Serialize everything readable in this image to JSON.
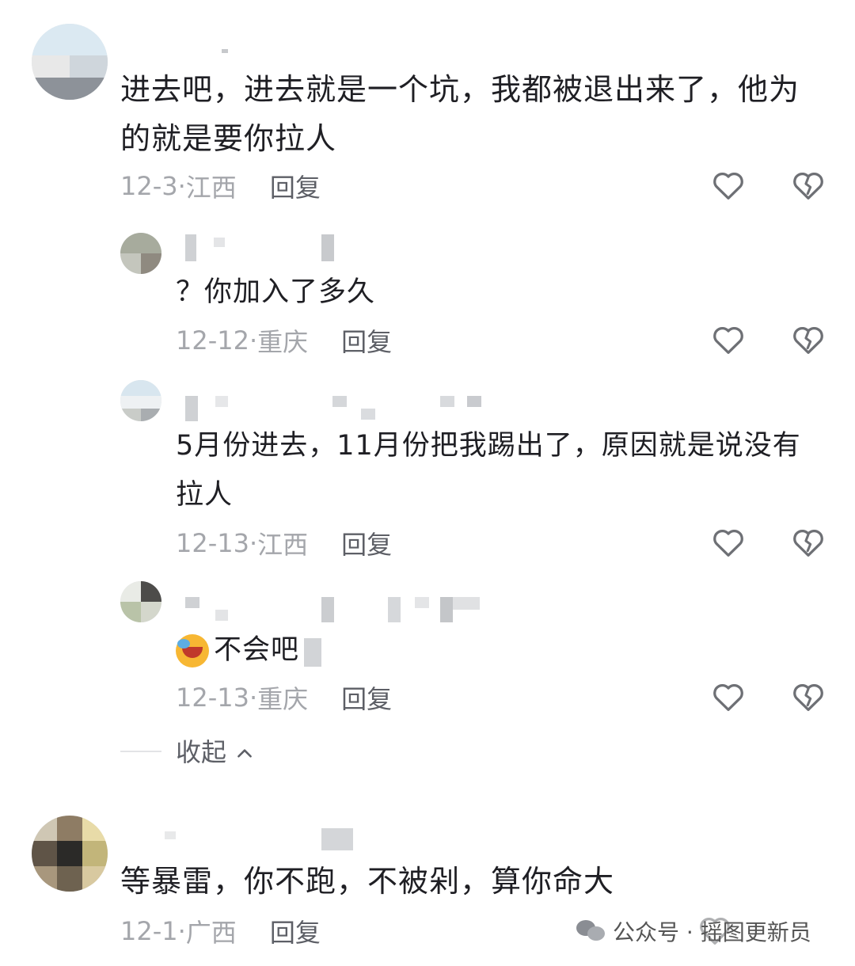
{
  "comments": [
    {
      "text": "进去吧，进去就是一个坑，我都被退出来了，他为的就是要你拉人",
      "date": "12-3",
      "location": "江西",
      "reply_label": "回复",
      "replies": [
        {
          "text": "？你加入了多久",
          "date": "12-12",
          "location": "重庆",
          "reply_label": "回复"
        },
        {
          "text": "5月份进去，11月份把我踢出了，原因就是说没有拉人",
          "date": "12-13",
          "location": "江西",
          "reply_label": "回复"
        },
        {
          "text": "不会吧",
          "emoji": "crying-laughing-emoji",
          "date": "12-13",
          "location": "重庆",
          "reply_label": "回复"
        }
      ],
      "collapse_label": "收起"
    },
    {
      "text": "等暴雷，你不跑，不被剁，算你命大",
      "date": "12-1",
      "location": "广西",
      "reply_label": "回复"
    }
  ],
  "separator": "·",
  "watermark": {
    "label": "公众号 · 摇图更新员"
  },
  "icons": {
    "like": "heart-icon",
    "dislike": "broken-heart-icon",
    "collapse": "chevron-up-icon",
    "watermark": "wechat-icon"
  },
  "colors": {
    "text": "#1f1f24",
    "meta": "#a4a6ab",
    "reply": "#5d5f66",
    "icon": "#6e7075"
  }
}
